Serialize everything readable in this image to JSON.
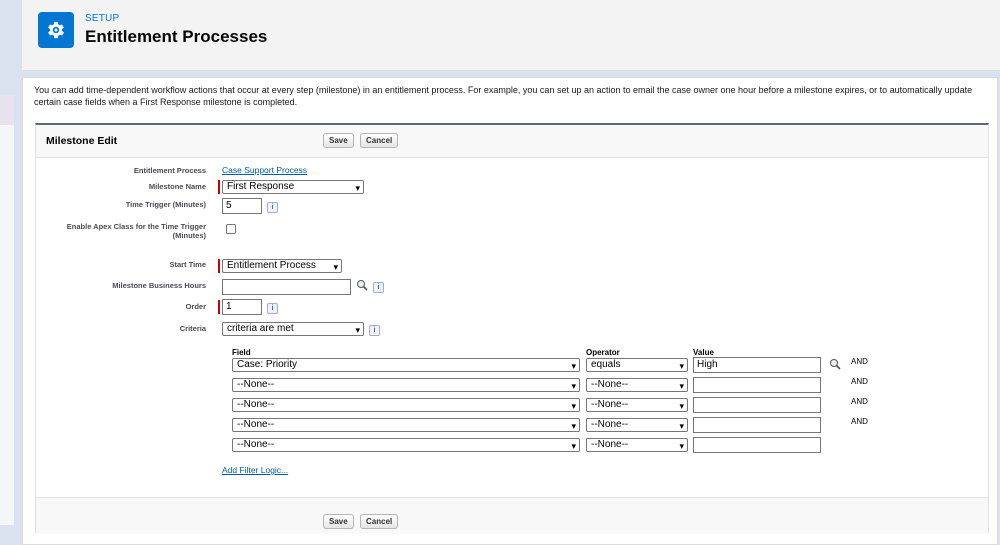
{
  "header": {
    "eyebrow": "SETUP",
    "title": "Entitlement Processes",
    "icon": "gear-icon",
    "icon_color": "#0176d3"
  },
  "intro": "You can add time-dependent workflow actions that occur at every step (milestone) in an entitlement process. For example, you can set up an action to email the case owner one hour before a milestone expires, or to automatically update certain case fields when a First Response milestone is completed.",
  "panel": {
    "title": "Milestone Edit",
    "save_label": "Save",
    "cancel_label": "Cancel"
  },
  "form": {
    "entitlement_process_label": "Entitlement Process",
    "entitlement_process_value": "Case Support Process",
    "milestone_name_label": "Milestone Name",
    "milestone_name_value": "First Response",
    "time_trigger_label": "Time Trigger (Minutes)",
    "time_trigger_value": "5",
    "apex_label": "Enable Apex Class for the Time Trigger (Minutes)",
    "start_time_label": "Start Time",
    "start_time_value": "Entitlement Process",
    "business_hours_label": "Milestone Business Hours",
    "business_hours_value": "",
    "order_label": "Order",
    "order_value": "1",
    "criteria_label": "Criteria",
    "criteria_value": "criteria are met",
    "info_glyph": "i"
  },
  "criteria": {
    "field_header": "Field",
    "operator_header": "Operator",
    "value_header": "Value",
    "rows": [
      {
        "field": "Case: Priority",
        "operator": "equals",
        "value": "High",
        "and": "AND"
      },
      {
        "field": "--None--",
        "operator": "--None--",
        "value": "",
        "and": "AND"
      },
      {
        "field": "--None--",
        "operator": "--None--",
        "value": "",
        "and": "AND"
      },
      {
        "field": "--None--",
        "operator": "--None--",
        "value": "",
        "and": "AND"
      },
      {
        "field": "--None--",
        "operator": "--None--",
        "value": "",
        "and": ""
      }
    ],
    "add_filter_logic": "Add Filter Logic..."
  },
  "dropdown_glyph": "⌄"
}
